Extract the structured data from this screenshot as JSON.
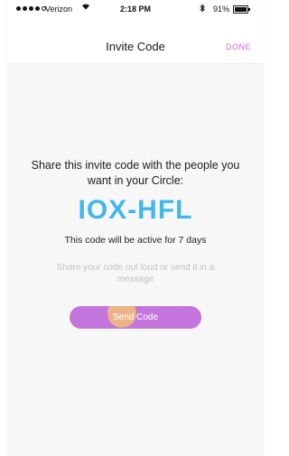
{
  "status_bar": {
    "carrier": "Verizon",
    "time": "2:18 PM",
    "battery_percent": "91%",
    "battery_level": 0.91,
    "signal_bars_filled": 4,
    "icons": [
      "signal-dots-icon",
      "wifi-icon",
      "bluetooth-icon",
      "battery-icon"
    ]
  },
  "nav": {
    "title": "Invite Code",
    "done_label": "DONE"
  },
  "main": {
    "instruction": "Share this invite code with the people you want in your Circle:",
    "invite_code": "IOX-HFL",
    "active_text": "This code will be active for 7 days",
    "hint": "Share your code out loud or send it in a message",
    "send_label": "Send Code"
  },
  "colors": {
    "accent_purple": "#c475dc",
    "code_blue": "#41b8ec",
    "tap_highlight": "#f5be78"
  }
}
